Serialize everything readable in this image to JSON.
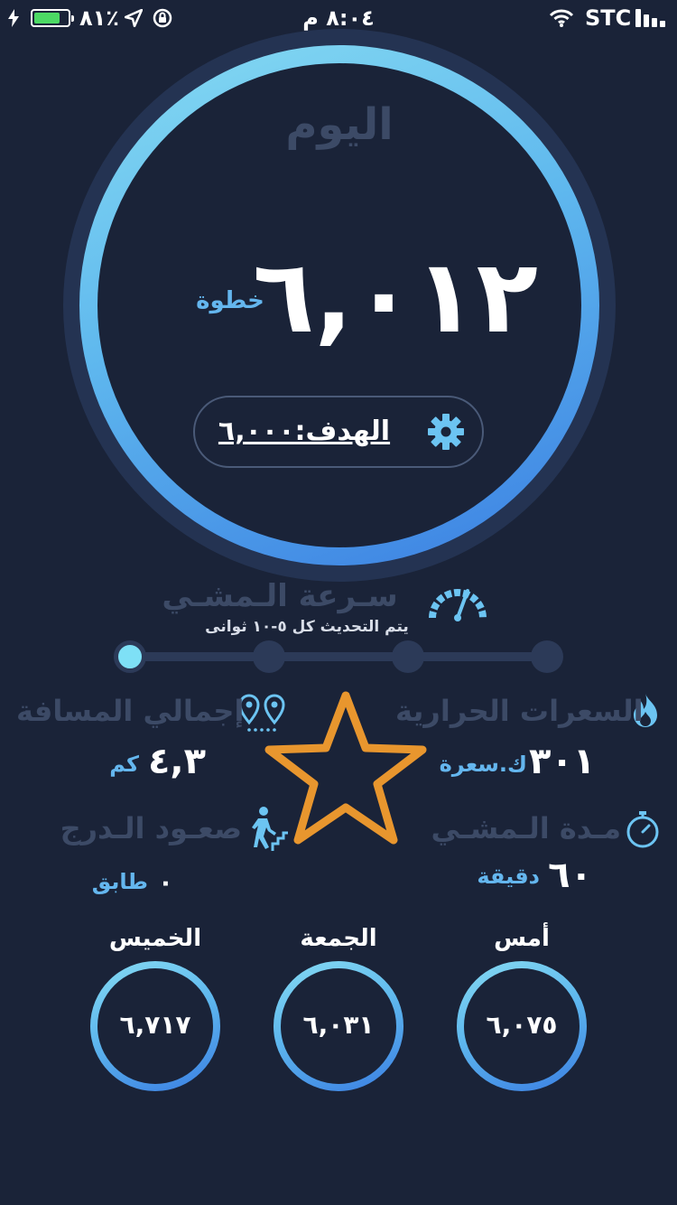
{
  "status_bar": {
    "battery_percent": "٨١٪",
    "battery_level": 0.81,
    "time": "٨:٠٤ م",
    "carrier": "STC"
  },
  "today": {
    "title": "اليوم",
    "steps": "٦,٠١٢",
    "steps_unit": "خطوة",
    "goal_label": "الهدف:٦,٠٠٠"
  },
  "speed": {
    "title": "سـرعة الـمشـي",
    "note": "يتم التحديث كل ٥-١٠ ثوانى",
    "levels": 4,
    "active_level": 1
  },
  "stats": {
    "calories": {
      "title": "السعرات الحرارية",
      "value": "٣٠١",
      "unit": "ك.سعرة"
    },
    "distance": {
      "title": "إجمالي المسافة",
      "value": "٤,٣",
      "unit": "كم"
    },
    "duration": {
      "title": "مـدة الـمشـي",
      "value": "٦٠",
      "unit": "دقيقة"
    },
    "stairs": {
      "title": "صعـود الـدرج",
      "value": "٠",
      "unit": "طابق"
    }
  },
  "history": [
    {
      "label": "أمس",
      "value": "٦,٠٧٥"
    },
    {
      "label": "الجمعة",
      "value": "٦,٠٣١"
    },
    {
      "label": "الخميس",
      "value": "٦,٧١٧"
    }
  ],
  "colors": {
    "background": "#1a2338",
    "accent": "#64b6ee",
    "star": "#e8962e",
    "muted_text": "#3c4a66"
  }
}
